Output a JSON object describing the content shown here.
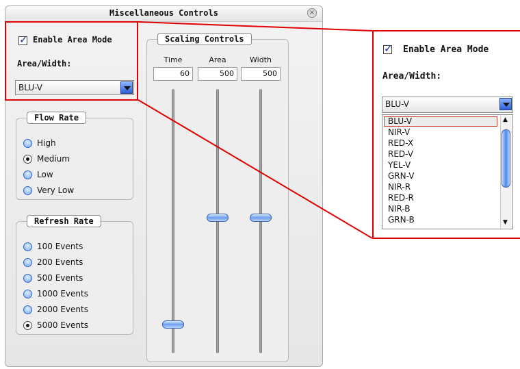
{
  "window": {
    "title": "Miscellaneous Controls",
    "close_glyph": "×"
  },
  "area_mode": {
    "checkbox_label": "Enable Area Mode",
    "checked": true,
    "width_label": "Area/Width:",
    "selected": "BLU-V"
  },
  "flow_rate": {
    "legend": "Flow Rate",
    "options": [
      "High",
      "Medium",
      "Low",
      "Very Low"
    ],
    "selected": "Medium"
  },
  "refresh_rate": {
    "legend": "Refresh Rate",
    "options": [
      "100 Events",
      "200 Events",
      "500 Events",
      "1000 Events",
      "2000 Events",
      "5000 Events"
    ],
    "selected": "5000 Events"
  },
  "scaling": {
    "legend": "Scaling Controls",
    "columns": [
      {
        "label": "Time",
        "value": "60"
      },
      {
        "label": "Area",
        "value": "500"
      },
      {
        "label": "Width",
        "value": "500"
      }
    ]
  },
  "zoom": {
    "checkbox_label": "Enable Area Mode",
    "width_label": "Area/Width:",
    "selected": "BLU-V",
    "options": [
      "BLU-V",
      "NIR-V",
      "RED-X",
      "RED-V",
      "YEL-V",
      "GRN-V",
      "NIR-R",
      "RED-R",
      "NIR-B",
      "GRN-B"
    ]
  },
  "colors": {
    "highlight": "#e00000",
    "accent": "#2d5fd6"
  }
}
